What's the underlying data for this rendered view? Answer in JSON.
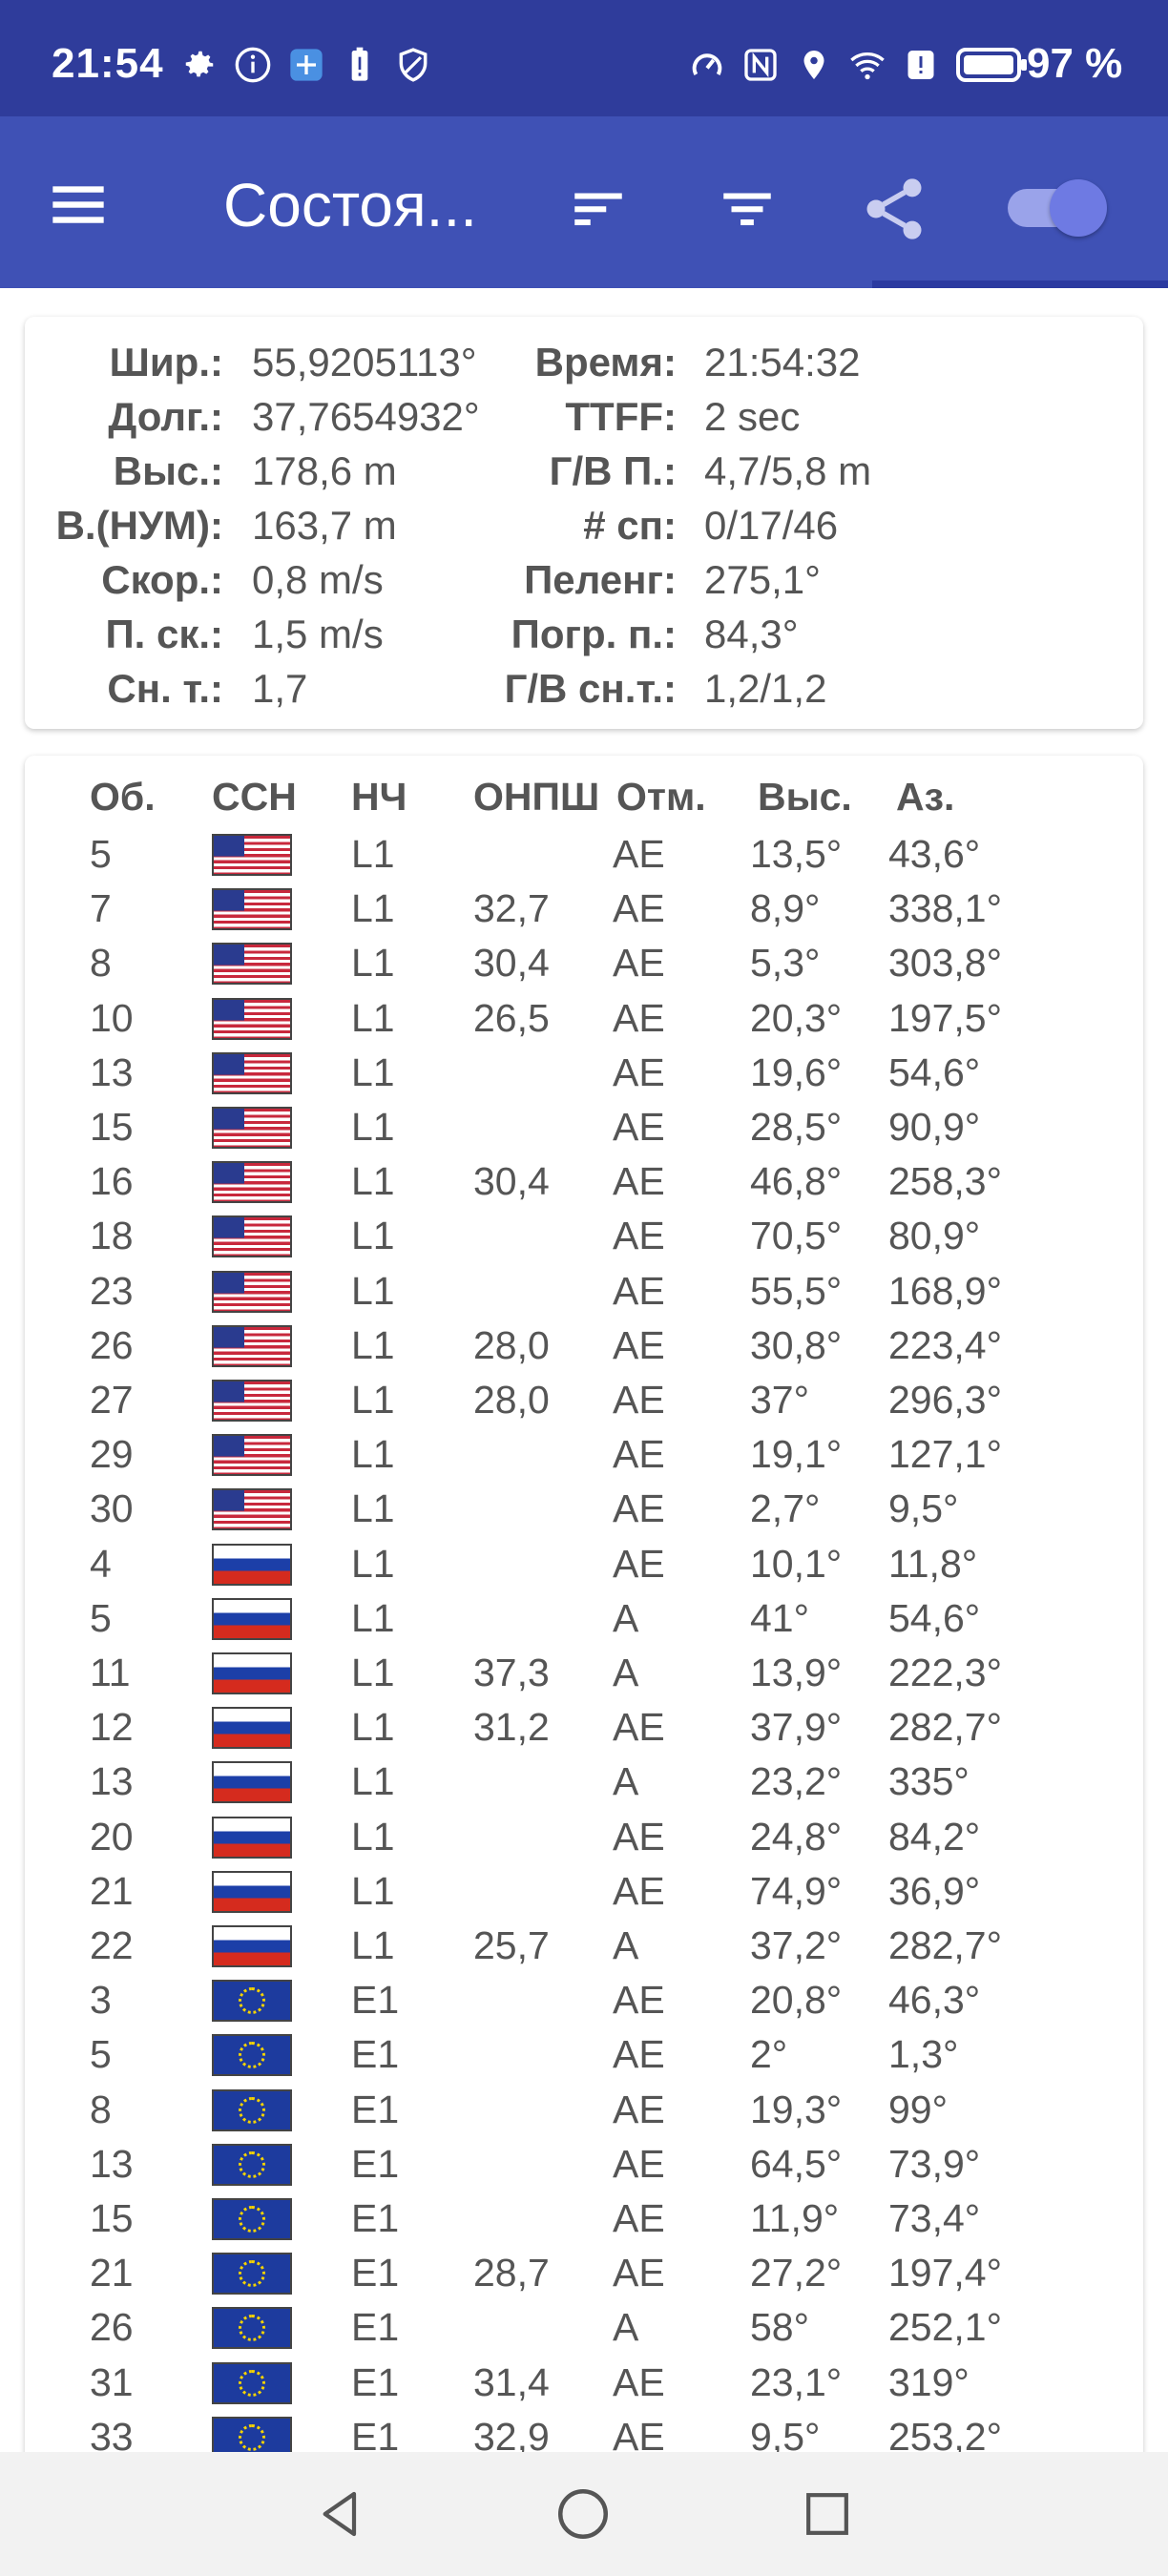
{
  "status_bar": {
    "time": "21:54",
    "battery": "97 %",
    "left_icons": [
      "gear-icon",
      "info-icon",
      "app-icon",
      "battery-alert-icon",
      "shield-icon"
    ],
    "right_icons": [
      "speed-icon",
      "nfc-icon",
      "location-icon",
      "wifi-icon",
      "alert-icon",
      "battery-icon"
    ]
  },
  "app_bar": {
    "title": "Состоя...",
    "actions": [
      "sort-icon",
      "filter-icon",
      "share-icon",
      "toggle-switch"
    ],
    "toggle_on": true,
    "colors": {
      "primary": "#3f51b5",
      "primary_dark": "#2f3c9b",
      "accent": "#7b85e6"
    }
  },
  "info": {
    "left": [
      {
        "label": "Шир.:",
        "value": "55,9205113°"
      },
      {
        "label": "Долг.:",
        "value": "37,7654932°"
      },
      {
        "label": "Выс.:",
        "value": "178,6 m"
      },
      {
        "label": "В.(НУМ):",
        "value": "163,7 m"
      },
      {
        "label": "Скор.:",
        "value": "0,8 m/s"
      },
      {
        "label": "П. ск.:",
        "value": "1,5 m/s"
      },
      {
        "label": "Сн. т.:",
        "value": "1,7"
      }
    ],
    "right": [
      {
        "label": "Время:",
        "value": "21:54:32"
      },
      {
        "label": "TTFF:",
        "value": "2 sec"
      },
      {
        "label": "Г/В П.:",
        "value": "4,7/5,8 m"
      },
      {
        "label": "# сп:",
        "value": "0/17/46"
      },
      {
        "label": "Пеленг:",
        "value": "275,1°"
      },
      {
        "label": "Погр. п.:",
        "value": "84,3°"
      },
      {
        "label": "Г/В сн.т.:",
        "value": "1,2/1,2"
      }
    ]
  },
  "sat_table": {
    "headers": [
      "Об.",
      "ССН",
      "НЧ",
      "ОНПШ",
      "Отм.",
      "Выс.",
      "Аз."
    ],
    "rows": [
      {
        "id": "5",
        "flag": "usa",
        "band": "L1",
        "cn0": "",
        "flags": "AE",
        "elev": "13,5°",
        "az": "43,6°"
      },
      {
        "id": "7",
        "flag": "usa",
        "band": "L1",
        "cn0": "32,7",
        "flags": "AE",
        "elev": "8,9°",
        "az": "338,1°"
      },
      {
        "id": "8",
        "flag": "usa",
        "band": "L1",
        "cn0": "30,4",
        "flags": "AE",
        "elev": "5,3°",
        "az": "303,8°"
      },
      {
        "id": "10",
        "flag": "usa",
        "band": "L1",
        "cn0": "26,5",
        "flags": "AE",
        "elev": "20,3°",
        "az": "197,5°"
      },
      {
        "id": "13",
        "flag": "usa",
        "band": "L1",
        "cn0": "",
        "flags": "AE",
        "elev": "19,6°",
        "az": "54,6°"
      },
      {
        "id": "15",
        "flag": "usa",
        "band": "L1",
        "cn0": "",
        "flags": "AE",
        "elev": "28,5°",
        "az": "90,9°"
      },
      {
        "id": "16",
        "flag": "usa",
        "band": "L1",
        "cn0": "30,4",
        "flags": "AE",
        "elev": "46,8°",
        "az": "258,3°"
      },
      {
        "id": "18",
        "flag": "usa",
        "band": "L1",
        "cn0": "",
        "flags": "AE",
        "elev": "70,5°",
        "az": "80,9°"
      },
      {
        "id": "23",
        "flag": "usa",
        "band": "L1",
        "cn0": "",
        "flags": "AE",
        "elev": "55,5°",
        "az": "168,9°"
      },
      {
        "id": "26",
        "flag": "usa",
        "band": "L1",
        "cn0": "28,0",
        "flags": "AE",
        "elev": "30,8°",
        "az": "223,4°"
      },
      {
        "id": "27",
        "flag": "usa",
        "band": "L1",
        "cn0": "28,0",
        "flags": "AE",
        "elev": "37°",
        "az": "296,3°"
      },
      {
        "id": "29",
        "flag": "usa",
        "band": "L1",
        "cn0": "",
        "flags": "AE",
        "elev": "19,1°",
        "az": "127,1°"
      },
      {
        "id": "30",
        "flag": "usa",
        "band": "L1",
        "cn0": "",
        "flags": "AE",
        "elev": "2,7°",
        "az": "9,5°"
      },
      {
        "id": "4",
        "flag": "rus",
        "band": "L1",
        "cn0": "",
        "flags": "AE",
        "elev": "10,1°",
        "az": "11,8°"
      },
      {
        "id": "5",
        "flag": "rus",
        "band": "L1",
        "cn0": "",
        "flags": "A",
        "elev": "41°",
        "az": "54,6°"
      },
      {
        "id": "11",
        "flag": "rus",
        "band": "L1",
        "cn0": "37,3",
        "flags": "A",
        "elev": "13,9°",
        "az": "222,3°"
      },
      {
        "id": "12",
        "flag": "rus",
        "band": "L1",
        "cn0": "31,2",
        "flags": "AE",
        "elev": "37,9°",
        "az": "282,7°"
      },
      {
        "id": "13",
        "flag": "rus",
        "band": "L1",
        "cn0": "",
        "flags": "A",
        "elev": "23,2°",
        "az": "335°"
      },
      {
        "id": "20",
        "flag": "rus",
        "band": "L1",
        "cn0": "",
        "flags": "AE",
        "elev": "24,8°",
        "az": "84,2°"
      },
      {
        "id": "21",
        "flag": "rus",
        "band": "L1",
        "cn0": "",
        "flags": "AE",
        "elev": "74,9°",
        "az": "36,9°"
      },
      {
        "id": "22",
        "flag": "rus",
        "band": "L1",
        "cn0": "25,7",
        "flags": "A",
        "elev": "37,2°",
        "az": "282,7°"
      },
      {
        "id": "3",
        "flag": "eu",
        "band": "E1",
        "cn0": "",
        "flags": "AE",
        "elev": "20,8°",
        "az": "46,3°"
      },
      {
        "id": "5",
        "flag": "eu",
        "band": "E1",
        "cn0": "",
        "flags": "AE",
        "elev": "2°",
        "az": "1,3°"
      },
      {
        "id": "8",
        "flag": "eu",
        "band": "E1",
        "cn0": "",
        "flags": "AE",
        "elev": "19,3°",
        "az": "99°"
      },
      {
        "id": "13",
        "flag": "eu",
        "band": "E1",
        "cn0": "",
        "flags": "AE",
        "elev": "64,5°",
        "az": "73,9°"
      },
      {
        "id": "15",
        "flag": "eu",
        "band": "E1",
        "cn0": "",
        "flags": "AE",
        "elev": "11,9°",
        "az": "73,4°"
      },
      {
        "id": "21",
        "flag": "eu",
        "band": "E1",
        "cn0": "28,7",
        "flags": "AE",
        "elev": "27,2°",
        "az": "197,4°"
      },
      {
        "id": "26",
        "flag": "eu",
        "band": "E1",
        "cn0": "",
        "flags": "A",
        "elev": "58°",
        "az": "252,1°"
      },
      {
        "id": "31",
        "flag": "eu",
        "band": "E1",
        "cn0": "31,4",
        "flags": "AE",
        "elev": "23,1°",
        "az": "319°"
      },
      {
        "id": "33",
        "flag": "eu",
        "band": "E1",
        "cn0": "32,9",
        "flags": "AE",
        "elev": "9,5°",
        "az": "253,2°"
      }
    ]
  },
  "nav_bar": {
    "buttons": [
      "back-icon",
      "home-icon",
      "recents-icon"
    ]
  }
}
